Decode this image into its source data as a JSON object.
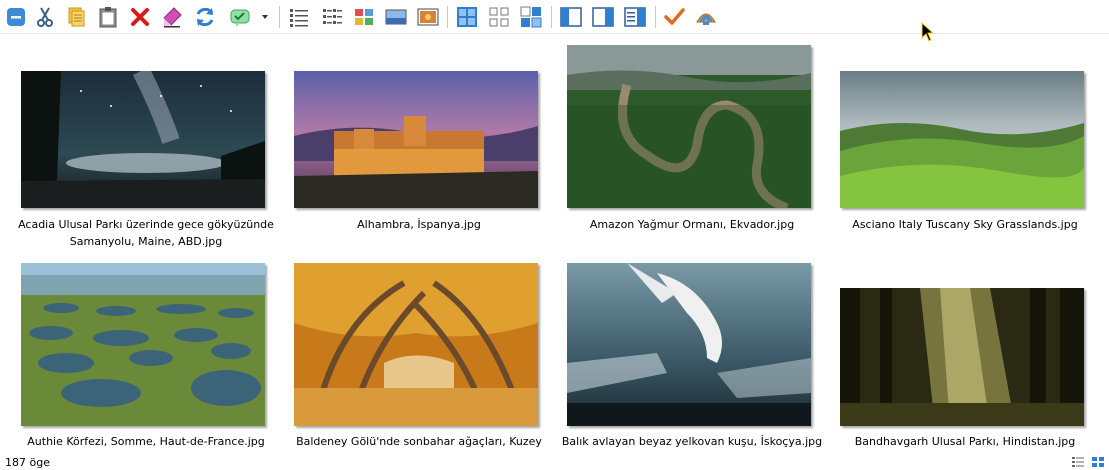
{
  "toolbar": {
    "buttons": [
      {
        "name": "minimize-icon"
      },
      {
        "name": "cut-icon"
      },
      {
        "name": "copy-icon"
      },
      {
        "name": "paste-icon"
      },
      {
        "name": "delete-icon"
      },
      {
        "name": "rename-icon"
      },
      {
        "name": "refresh-icon"
      },
      {
        "name": "select-icon"
      },
      {
        "name": "dropdown-arrow-icon"
      },
      {
        "name": "view-details-icon"
      },
      {
        "name": "view-list-icon"
      },
      {
        "name": "view-thumbnails-icon"
      },
      {
        "name": "view-filmstrip-icon"
      },
      {
        "name": "view-slideshow-icon"
      },
      {
        "name": "view-grid-icon"
      },
      {
        "name": "view-grid-small-icon"
      },
      {
        "name": "view-grid-mixed-icon"
      },
      {
        "name": "layout-left-pane-icon"
      },
      {
        "name": "layout-right-pane-icon"
      },
      {
        "name": "layout-preview-pane-icon"
      },
      {
        "name": "checkmark-icon"
      },
      {
        "name": "shell-icon"
      }
    ]
  },
  "files": [
    {
      "caption": "Acadia Ulusal Parkı üzerinde gece gökyüzünde Samanyolu, Maine, ABD.jpg"
    },
    {
      "caption": "Alhambra, İspanya.jpg"
    },
    {
      "caption": "Amazon Yağmur Ormanı, Ekvador.jpg"
    },
    {
      "caption": "Asciano Italy Tuscany Sky Grasslands.jpg"
    },
    {
      "caption": "Authie Körfezi, Somme, Haut-de-France.jpg"
    },
    {
      "caption": "Baldeney Gölü'nde sonbahar ağaçları, Kuzey"
    },
    {
      "caption": "Balık avlayan beyaz yelkovan kuşu, İskoçya.jpg"
    },
    {
      "caption": "Bandhavgarh Ulusal Parkı, Hindistan.jpg"
    }
  ],
  "status": {
    "item_count": "187 öge"
  },
  "colors": {
    "accent_blue": "#2f7fd0",
    "delete_red": "#d61b1b",
    "check_orange": "#e06a1a"
  }
}
